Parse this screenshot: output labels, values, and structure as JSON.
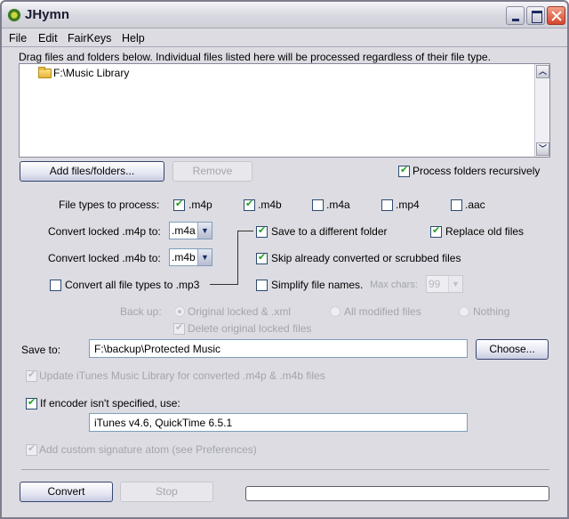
{
  "window": {
    "title": "JHymn",
    "icon": "jhymn-app-icon",
    "controls": [
      "minimize",
      "maximize",
      "close"
    ]
  },
  "menu": [
    "File",
    "Edit",
    "FairKeys",
    "Help"
  ],
  "drop_area": {
    "instructions": "Drag files and folders below. Individual files listed here will be processed regardless of their file type.",
    "items": [
      {
        "icon": "folder-icon",
        "label": "F:\\Music Library"
      }
    ]
  },
  "buttons": {
    "add": "Add files/folders...",
    "remove": "Remove",
    "choose": "Choose...",
    "convert": "Convert",
    "stop": "Stop"
  },
  "process_recursively": {
    "label": "Process folders recursively",
    "checked": true
  },
  "file_types": {
    "label": "File types to process:",
    "options": [
      {
        "label": ".m4p",
        "checked": true
      },
      {
        "label": ".m4b",
        "checked": true
      },
      {
        "label": ".m4a",
        "checked": false
      },
      {
        "label": ".mp4",
        "checked": false
      },
      {
        "label": ".aac",
        "checked": false
      }
    ]
  },
  "convert_m4p": {
    "label": "Convert locked .m4p to:",
    "value": ".m4a"
  },
  "convert_m4b": {
    "label": "Convert locked .m4b to:",
    "value": ".m4b"
  },
  "convert_all_mp3": {
    "label": "Convert all file types to .mp3",
    "checked": false
  },
  "save_different_folder": {
    "label": "Save to a different folder",
    "checked": true
  },
  "replace_old": {
    "label": "Replace old files",
    "checked": true
  },
  "skip_converted": {
    "label": "Skip already converted or scrubbed files",
    "checked": true
  },
  "simplify_names": {
    "label": "Simplify file names.",
    "checked": false,
    "max_chars_label": "Max chars:",
    "max_chars_value": "99"
  },
  "backup": {
    "label": "Back up:",
    "options": [
      {
        "label": "Original locked & .xml",
        "selected": true
      },
      {
        "label": "All modified files",
        "selected": false
      },
      {
        "label": "Nothing",
        "selected": false
      }
    ],
    "delete_original": {
      "label": "Delete original locked files",
      "checked": true
    }
  },
  "save_to": {
    "label": "Save to:",
    "value": "F:\\backup\\Protected Music"
  },
  "update_itunes": {
    "label": "Update iTunes Music Library for converted .m4p & .m4b files",
    "checked": true
  },
  "encoder": {
    "label": "If encoder isn't specified, use:",
    "checked": true,
    "value": "iTunes v4.6, QuickTime 6.5.1"
  },
  "signature_atom": {
    "label": "Add custom signature atom (see Preferences)",
    "checked": true
  },
  "progress": {
    "value": 0
  }
}
